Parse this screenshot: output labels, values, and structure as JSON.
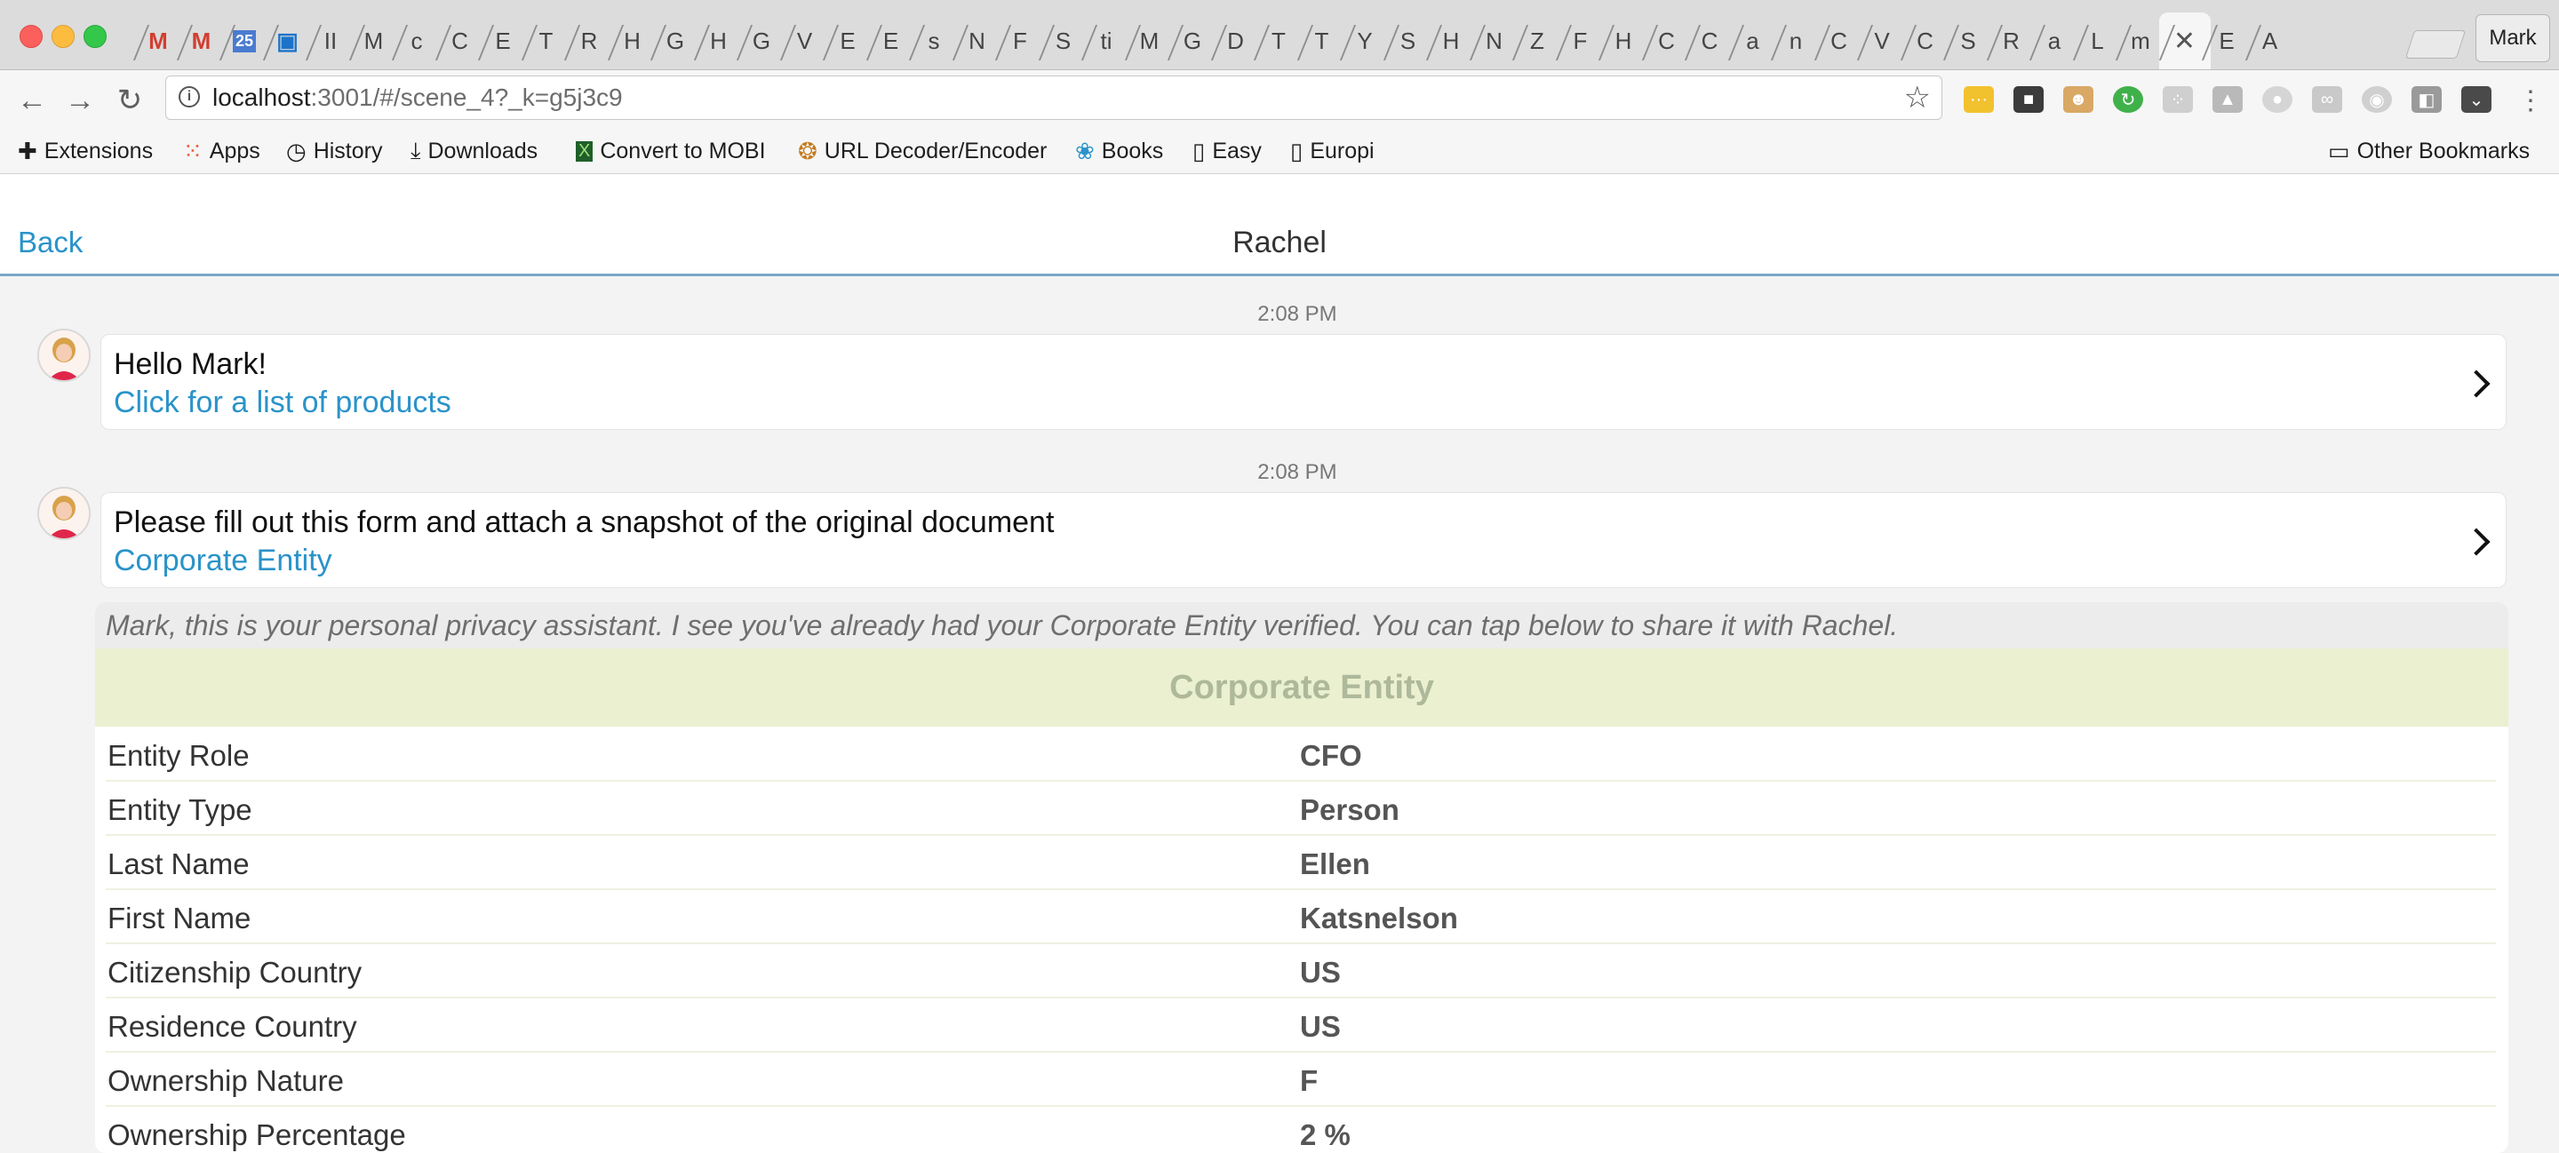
{
  "browser": {
    "tabs": [
      {
        "label": "M"
      },
      {
        "label": "M"
      },
      {
        "label": "25"
      },
      {
        "label": "▣"
      },
      {
        "label": "II"
      },
      {
        "label": "M"
      },
      {
        "label": "c"
      },
      {
        "label": "C"
      },
      {
        "label": "E"
      },
      {
        "label": "T"
      },
      {
        "label": "R"
      },
      {
        "label": "H"
      },
      {
        "label": "G"
      },
      {
        "label": "H"
      },
      {
        "label": "G"
      },
      {
        "label": "V"
      },
      {
        "label": "E"
      },
      {
        "label": "E"
      },
      {
        "label": "s"
      },
      {
        "label": "N"
      },
      {
        "label": "F"
      },
      {
        "label": "S"
      },
      {
        "label": "ti"
      },
      {
        "label": "M"
      },
      {
        "label": "G"
      },
      {
        "label": "D"
      },
      {
        "label": "T"
      },
      {
        "label": "T"
      },
      {
        "label": "Y"
      },
      {
        "label": "S"
      },
      {
        "label": "H"
      },
      {
        "label": "N"
      },
      {
        "label": "Z"
      },
      {
        "label": "F"
      },
      {
        "label": "H"
      },
      {
        "label": "C"
      },
      {
        "label": "C"
      },
      {
        "label": "a"
      },
      {
        "label": "n"
      },
      {
        "label": "C"
      },
      {
        "label": "V"
      },
      {
        "label": "C"
      },
      {
        "label": "S"
      },
      {
        "label": "R"
      },
      {
        "label": "a"
      },
      {
        "label": "L"
      },
      {
        "label": "m"
      },
      {
        "label": "✕"
      },
      {
        "label": "E"
      },
      {
        "label": "A"
      }
    ],
    "profile_name": "Mark",
    "url_host": "localhost",
    "url_path": ":3001/#/scene_4?_k=g5j3c9",
    "bookmarks": {
      "extensions": "Extensions",
      "apps": "Apps",
      "history": "History",
      "downloads": "Downloads",
      "convert": "Convert to MOBI",
      "url_decoder": "URL Decoder/Encoder",
      "books": "Books",
      "easy": "Easy",
      "europi": "Europi",
      "other": "Other Bookmarks"
    },
    "colors": {
      "accent": "#2a93c9"
    }
  },
  "chat": {
    "back_label": "Back",
    "title": "Rachel",
    "messages": [
      {
        "time": "2:08 PM",
        "text": "Hello Mark!",
        "link": "Click for a list of products"
      },
      {
        "time": "2:08 PM",
        "text": "Please fill out this form and attach a snapshot of the original document",
        "link": "Corporate Entity"
      }
    ],
    "assistant": {
      "note": "Mark, this is your personal privacy assistant. I see you've already had your Corporate Entity verified. You can tap below to share it with Rachel.",
      "form_title": "Corporate Entity",
      "rows": [
        {
          "label": "Entity Role",
          "value": "CFO"
        },
        {
          "label": "Entity Type",
          "value": "Person"
        },
        {
          "label": "Last Name",
          "value": "Ellen"
        },
        {
          "label": "First Name",
          "value": "Katsnelson"
        },
        {
          "label": "Citizenship Country",
          "value": "US"
        },
        {
          "label": "Residence Country",
          "value": "US"
        },
        {
          "label": "Ownership Nature",
          "value": "F"
        },
        {
          "label": "Ownership Percentage",
          "value": "2 %"
        }
      ]
    }
  }
}
